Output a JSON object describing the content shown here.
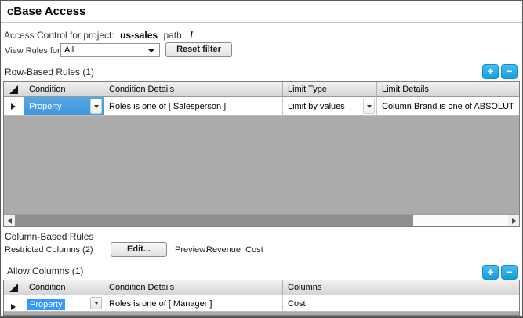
{
  "window": {
    "title": "cBase Access"
  },
  "access_control": {
    "prefix": "Access Control for project:",
    "project": "us-sales",
    "path_label": "path:",
    "path_value": "/"
  },
  "filter": {
    "label": "View Rules for:",
    "selected_option": "All",
    "reset_button_label": "Reset filter"
  },
  "row_rules": {
    "section_title": "Row-Based Rules (1)",
    "add_button": "+",
    "remove_button": "−",
    "columns": [
      "Condition",
      "Condition Details",
      "Limit Type",
      "Limit Details"
    ],
    "rows": [
      {
        "condition": "Property",
        "condition_details": "Roles is one of [ Salesperson ]",
        "limit_type": "Limit by values",
        "limit_details": "Column Brand is one of ABSOLUT"
      }
    ]
  },
  "column_rules": {
    "section_title": "Column-Based Rules",
    "restricted_label": "Restricted Columns (2)",
    "edit_button_label": "Edit...",
    "preview_label": "Preview:",
    "preview_value": "Revenue, Cost",
    "allow_section_title": "Allow Columns (1)",
    "add_button": "+",
    "remove_button": "−",
    "columns": [
      "Condition",
      "Condition Details",
      "Columns"
    ],
    "rows": [
      {
        "condition": "Property",
        "condition_details": "Roles is one of [ Manager ]",
        "columns_value": "Cost"
      }
    ]
  },
  "colors": {
    "accent_button_blue": "#29a8e0",
    "selected_cell_blue": "#4a9ee4",
    "text_selection_blue": "#3399ff",
    "grid_empty_area": "#ababab"
  }
}
